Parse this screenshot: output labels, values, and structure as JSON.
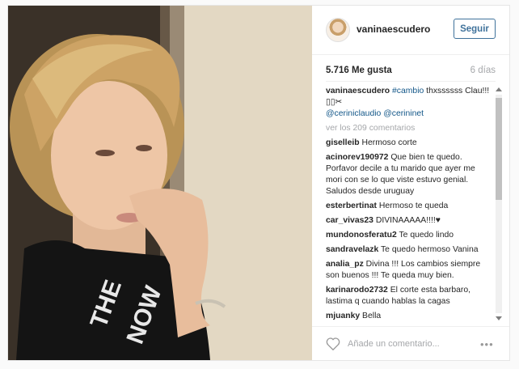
{
  "colors": {
    "link": "#125688",
    "follow": "#3f729b",
    "muted": "#a5a7aa",
    "text": "#262626"
  },
  "post": {
    "image_alt": "selfie photo of a woman with short blonde hair wearing a black tank top"
  },
  "header": {
    "username": "vaninaescudero",
    "follow_label": "Seguir",
    "avatar_icon": "profile-avatar"
  },
  "meta": {
    "likes": "5.716 Me gusta",
    "time": "6 días"
  },
  "caption": {
    "user": "vaninaescudero",
    "hashtag": "#cambio",
    "text": " thxssssss Clau!!!",
    "emoji": "▯▯✂",
    "mention1": "@ceriniclaudio",
    "mention2": "@cerininet"
  },
  "view_all": "ver los 209 comentarios",
  "comments": [
    {
      "user": "giselleib",
      "text": "Hermoso corte"
    },
    {
      "user": "acinorev190972",
      "text": "Que bien te quedo. Porfavor decile a tu marido que ayer me mori con se lo que viste estuvo genial. Saludos desde uruguay"
    },
    {
      "user": "esterbertinat",
      "text": "Hermoso te queda"
    },
    {
      "user": "car_vivas23",
      "text": "DIVINAAAAA!!!!♥"
    },
    {
      "user": "mundonosferatu2",
      "text": "Te quedo lindo"
    },
    {
      "user": "sandravelazk",
      "text": "Te quedo hermoso Vanina"
    },
    {
      "user": "analia_pz",
      "text": "Divina !!! Los cambios siempre son buenos !!! Te queda muy bien."
    },
    {
      "user": "karinarodo2732",
      "text": "El corte esta barbaro, lastima q cuando hablas la cagas"
    },
    {
      "user": "mjuanky",
      "text": "Bella"
    }
  ],
  "footer": {
    "placeholder": "Añade un comentario...",
    "heart_icon": "heart-outline",
    "more_icon": "more-dots"
  }
}
